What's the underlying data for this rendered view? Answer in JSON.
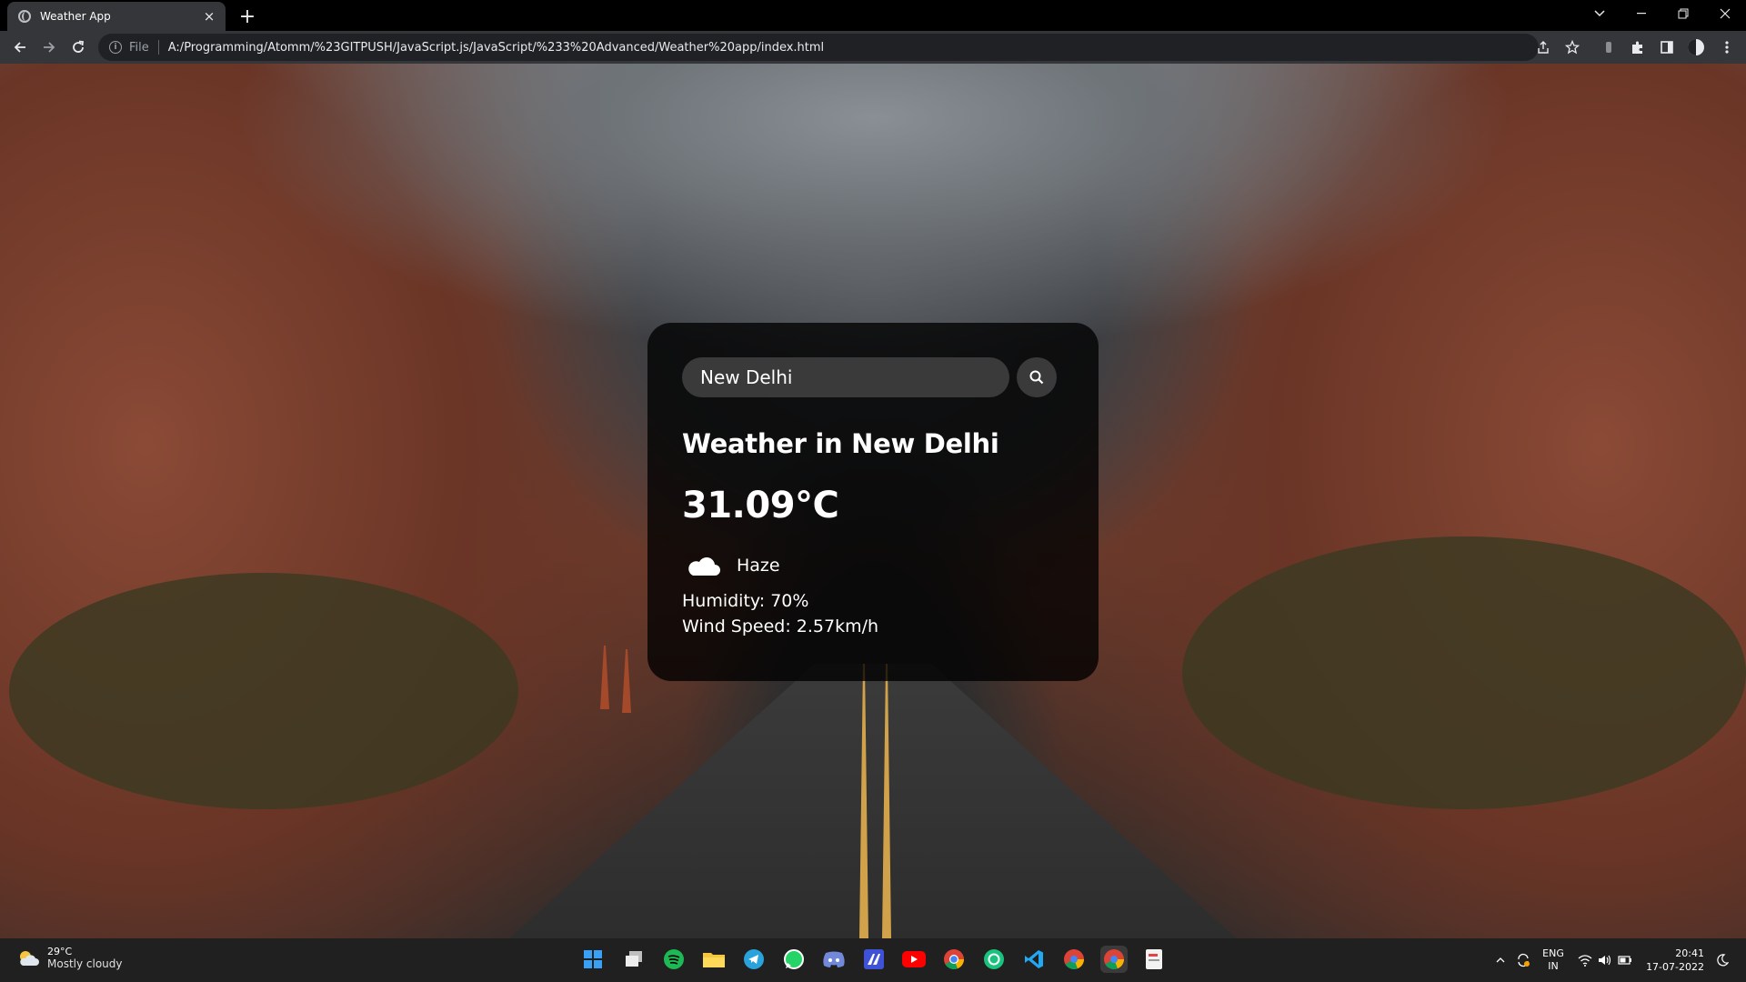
{
  "browser": {
    "tab_title": "Weather App",
    "tab_close": "×",
    "new_tab": "+",
    "scheme_label": "File",
    "url": "A:/Programming/Atomm/%23GITPUSH/JavaScript.js/JavaScript/%233%20Advanced/Weather%20app/index.html",
    "icons": [
      "back-icon",
      "forward-icon",
      "reload-icon",
      "info-icon",
      "share-icon",
      "star-icon",
      "extension-icon",
      "puzzle-icon",
      "sidepanel-icon",
      "profile-icon",
      "menu-icon"
    ]
  },
  "weather_card": {
    "search_value": "New Delhi",
    "city_heading": "Weather in New Delhi",
    "temperature": "31.09°C",
    "condition": "Haze",
    "humidity": "Humidity: 70%",
    "wind": "Wind Speed: 2.57km/h"
  },
  "taskbar": {
    "widget_temp": "29°C",
    "widget_desc": "Mostly cloudy",
    "lang_top": "ENG",
    "lang_bottom": "IN",
    "time": "20:41",
    "date": "17-07-2022"
  },
  "colors": {
    "card_bg": "#000000c7",
    "chrome_dark": "#35363a",
    "taskbar": "#202020"
  }
}
